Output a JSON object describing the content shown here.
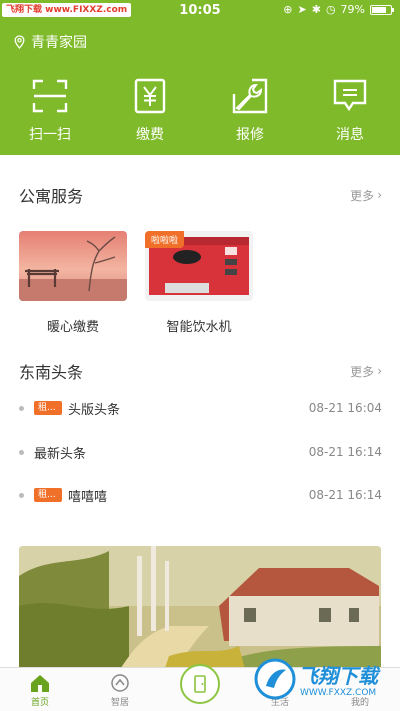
{
  "status_bar": {
    "watermark": "飞翔下载 www.FIXXZ.com",
    "time": "10:05",
    "battery_percent": "79%",
    "battery_level": 0.79
  },
  "header": {
    "location": "青青家园",
    "actions": [
      {
        "label": "扫一扫",
        "icon": "scan-icon"
      },
      {
        "label": "缴费",
        "icon": "yen-icon"
      },
      {
        "label": "报修",
        "icon": "wrench-icon"
      },
      {
        "label": "消息",
        "icon": "message-icon"
      }
    ]
  },
  "apartment_services": {
    "title": "公寓服务",
    "more": "更多",
    "items": [
      {
        "label": "暖心缴费"
      },
      {
        "label": "智能饮水机",
        "badge": "啦啦啦"
      }
    ]
  },
  "news": {
    "title": "东南头条",
    "more": "更多",
    "items": [
      {
        "tag": "租...",
        "title": "头版头条",
        "time": "08-21 16:04"
      },
      {
        "tag": "",
        "title": "最新头条",
        "time": "08-21 16:14"
      },
      {
        "tag": "租...",
        "title": "嘻嘻嘻",
        "time": "08-21 16:14"
      }
    ]
  },
  "tab_bar": {
    "tabs": [
      {
        "label": "首页",
        "active": true
      },
      {
        "label": "智居"
      },
      {
        "label": "生活"
      },
      {
        "label": "我的"
      }
    ]
  },
  "bottom_watermark": {
    "text": "飞翔下载",
    "url": "WWW.FXXZ.COM"
  },
  "colors": {
    "brand_green": "#7fba2a",
    "tag_orange": "#f0702a"
  }
}
